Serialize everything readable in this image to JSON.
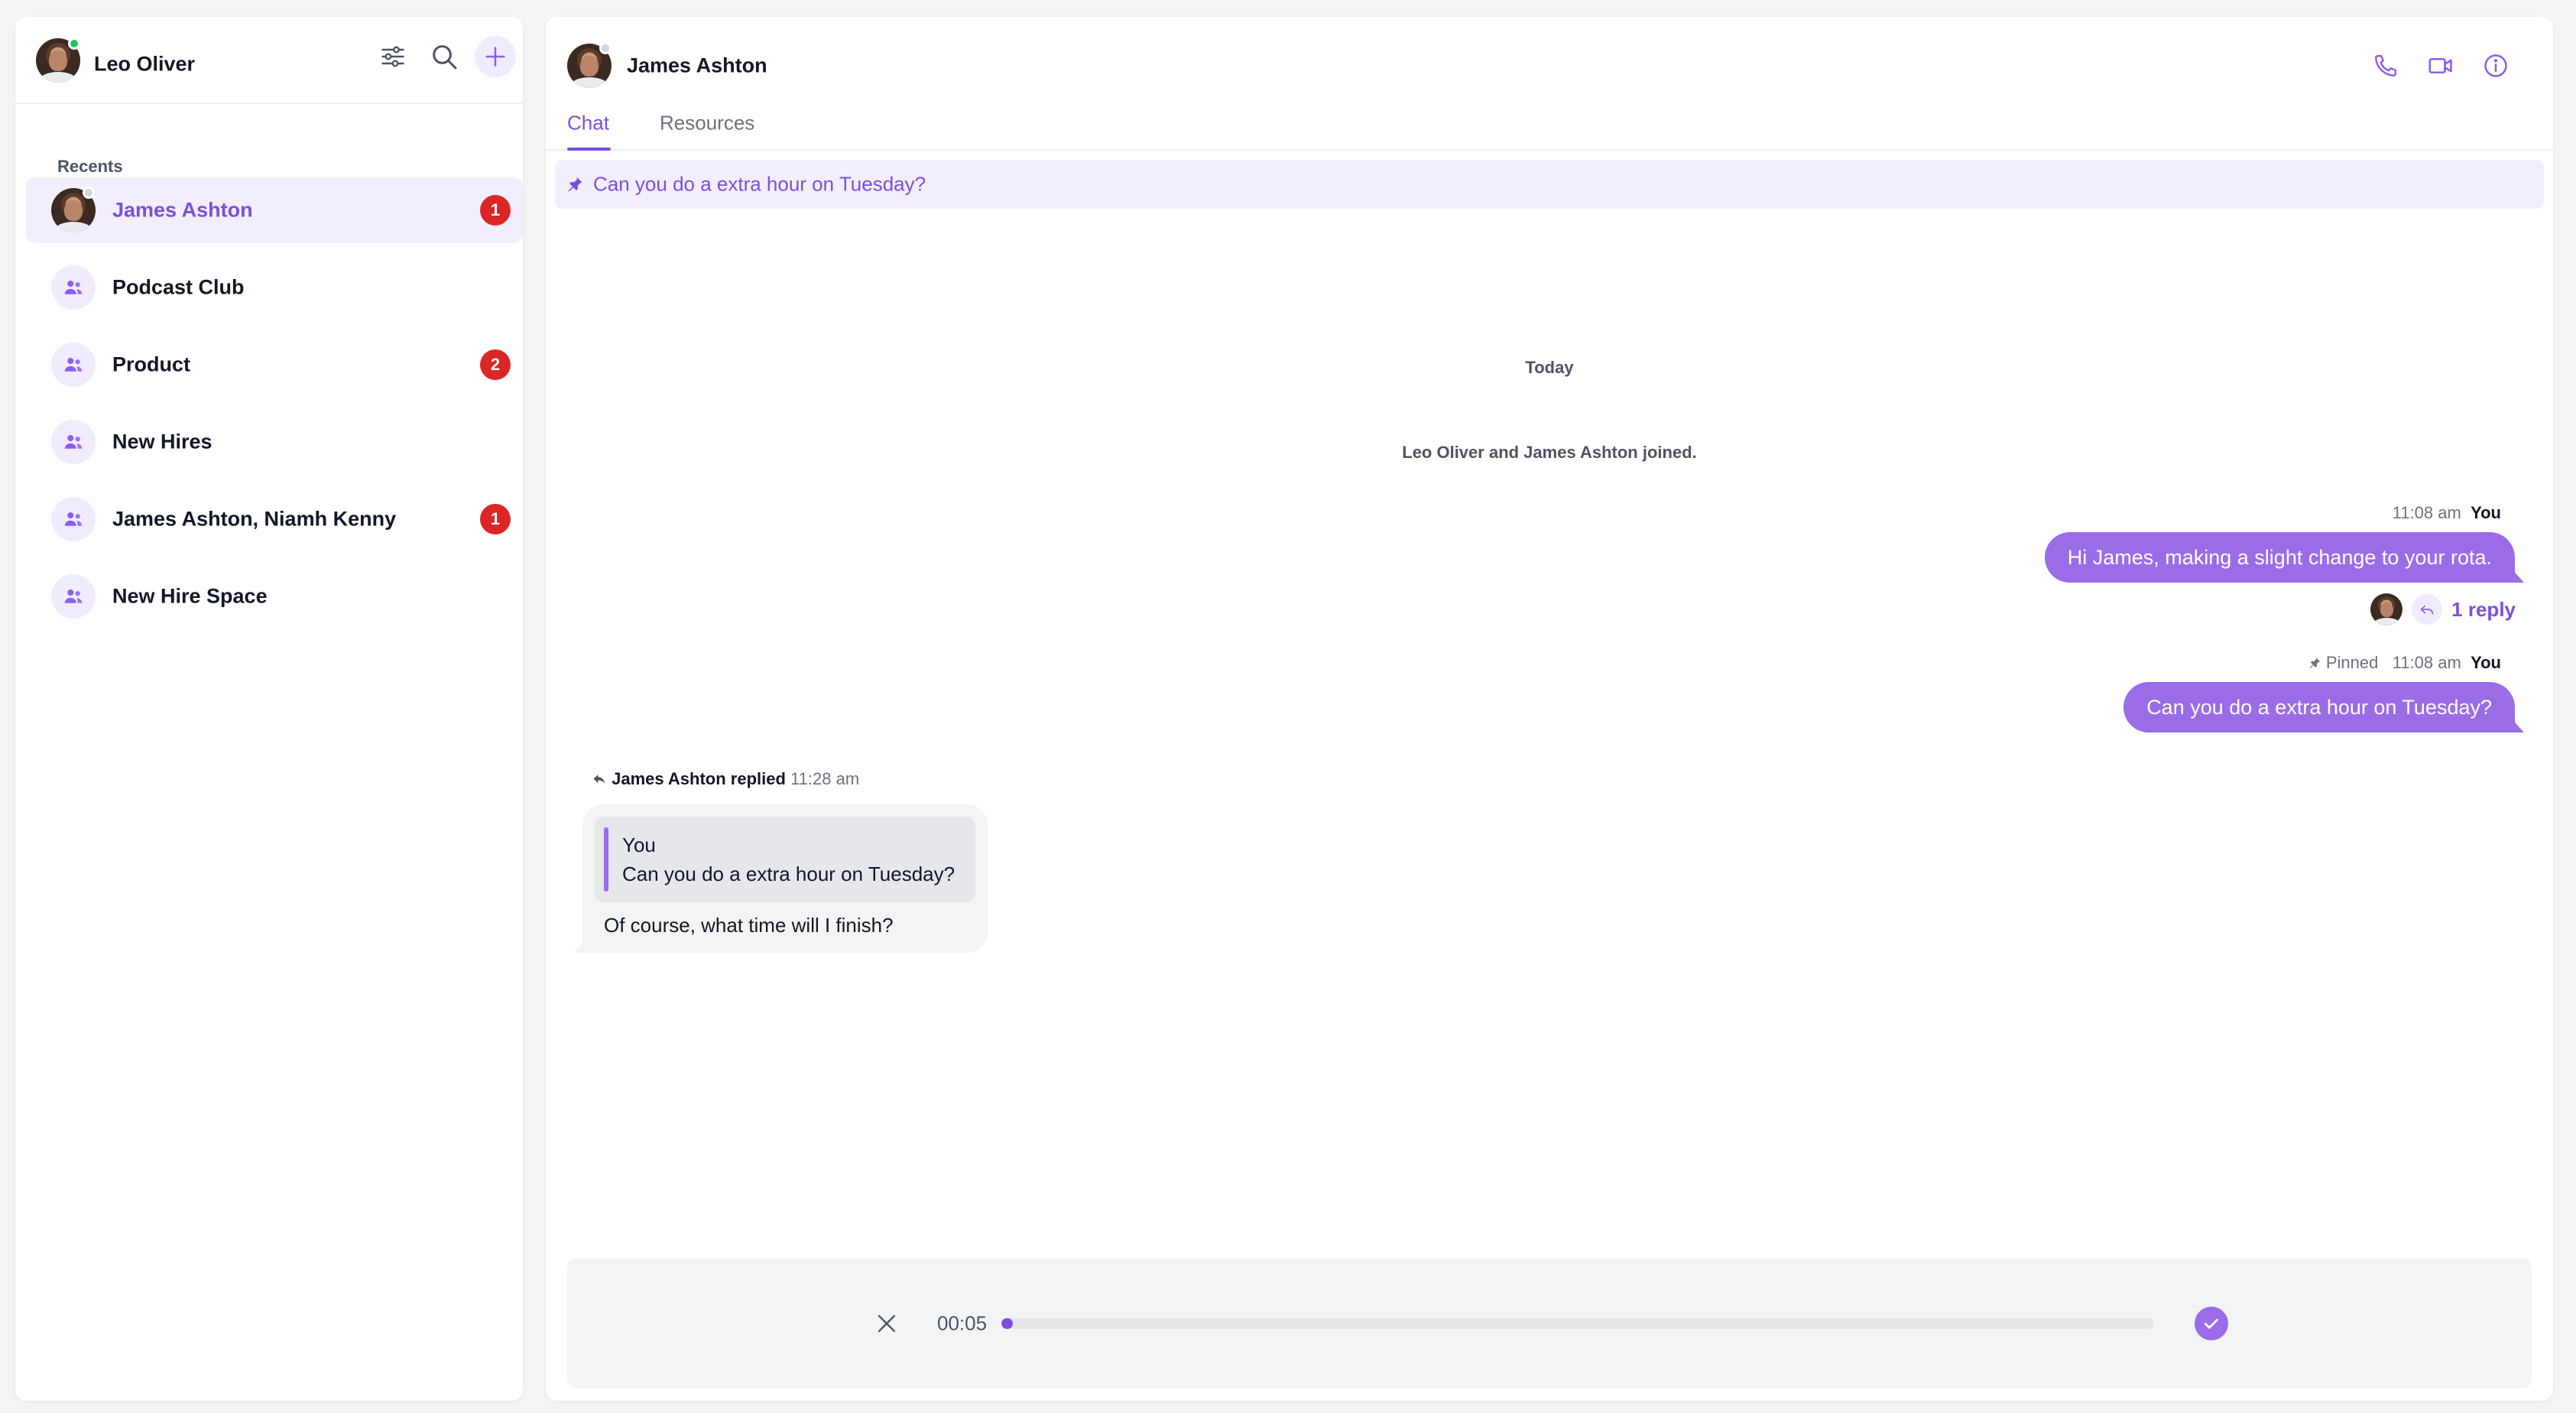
{
  "current_user": {
    "name": "Leo Oliver",
    "status": "online"
  },
  "sidebar": {
    "recents_label": "Recents",
    "conversations": [
      {
        "name": "James Ashton",
        "type": "direct",
        "unread": "1",
        "active": true
      },
      {
        "name": "Podcast Club",
        "type": "group",
        "unread": ""
      },
      {
        "name": "Product",
        "type": "group",
        "unread": "2"
      },
      {
        "name": "New Hires",
        "type": "group",
        "unread": ""
      },
      {
        "name": "James Ashton, Niamh Kenny",
        "type": "group",
        "unread": "1"
      },
      {
        "name": "New Hire Space",
        "type": "group",
        "unread": ""
      }
    ],
    "icons": [
      "filter-icon",
      "search-icon",
      "plus-icon"
    ]
  },
  "chat": {
    "contact_name": "James Ashton",
    "header_icons": [
      "phone-icon",
      "video-icon",
      "info-icon"
    ],
    "tabs": [
      {
        "label": "Chat",
        "active": true
      },
      {
        "label": "Resources",
        "active": false
      }
    ],
    "pinned_message": "Can you do a extra hour on Tuesday?",
    "date_separator": "Today",
    "system_message": "Leo Oliver and James Ashton joined.",
    "messages": [
      {
        "direction": "outgoing",
        "time": "11:08 am",
        "author": "You",
        "text": "Hi James, making a slight change to your rota.",
        "reply_count_label": "1 reply"
      },
      {
        "direction": "outgoing",
        "pinned_label": "Pinned",
        "time": "11:08 am",
        "author": "You",
        "text": "Can you do a extra hour on Tuesday?"
      },
      {
        "direction": "incoming",
        "reply_header": "James Ashton replied",
        "time": "11:28 am",
        "quoted_author": "You",
        "quoted_text": "Can you do a extra hour on Tuesday?",
        "text": "Of course, what time will I finish?"
      }
    ],
    "recorder": {
      "elapsed": "00:05",
      "progress_percent": 1
    }
  },
  "colors": {
    "accent": "#7c4fdb",
    "bubble_out": "#9b6ce8",
    "badge": "#dc2626",
    "online": "#22c55e"
  }
}
